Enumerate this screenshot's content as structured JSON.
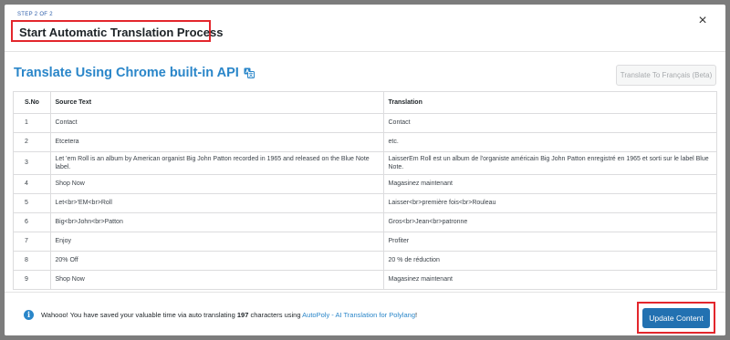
{
  "header": {
    "step": "STEP 2 OF 2",
    "title": "Start Automatic Translation Process",
    "close": "×"
  },
  "section": {
    "heading": "Translate Using Chrome built-in API",
    "lang_button": "Translate To Français (Beta)"
  },
  "table": {
    "headers": [
      "S.No",
      "Source Text",
      "Translation"
    ],
    "rows": [
      {
        "no": "1",
        "source": "Contact",
        "translation": "Contact"
      },
      {
        "no": "2",
        "source": "Etcetera",
        "translation": "etc."
      },
      {
        "no": "3",
        "source": "Let 'em Roll is an album by American organist Big John Patton recorded in 1965 and released on the Blue Note label.",
        "translation": "LaisserEm Roll est un album de l'organiste américain Big John Patton enregistré en 1965 et sorti sur le label Blue Note."
      },
      {
        "no": "4",
        "source": "Shop Now",
        "translation": "Magasinez maintenant"
      },
      {
        "no": "5",
        "source": "Let<br>'EM<br>Roll",
        "translation": "Laisser<br>première fois<br>Rouleau"
      },
      {
        "no": "6",
        "source": "Big<br>John<br>Patton",
        "translation": "Gros<br>Jean<br>patronne"
      },
      {
        "no": "7",
        "source": "Enjoy",
        "translation": "Profiter"
      },
      {
        "no": "8",
        "source": "20% Off",
        "translation": "20 % de réduction"
      },
      {
        "no": "9",
        "source": "Shop Now",
        "translation": "Magasinez maintenant"
      }
    ]
  },
  "footer": {
    "msg_prefix": "Wahooo! You have saved your valuable time via auto translating ",
    "char_count": "197",
    "msg_middle": " characters using ",
    "link_text": "AutoPoly - AI Translation for Polylang",
    "msg_suffix": "!",
    "update_button": "Update Content"
  },
  "colors": {
    "accent": "#2a86c9",
    "primary_button": "#2271b1",
    "highlight_border": "#e3262c"
  }
}
